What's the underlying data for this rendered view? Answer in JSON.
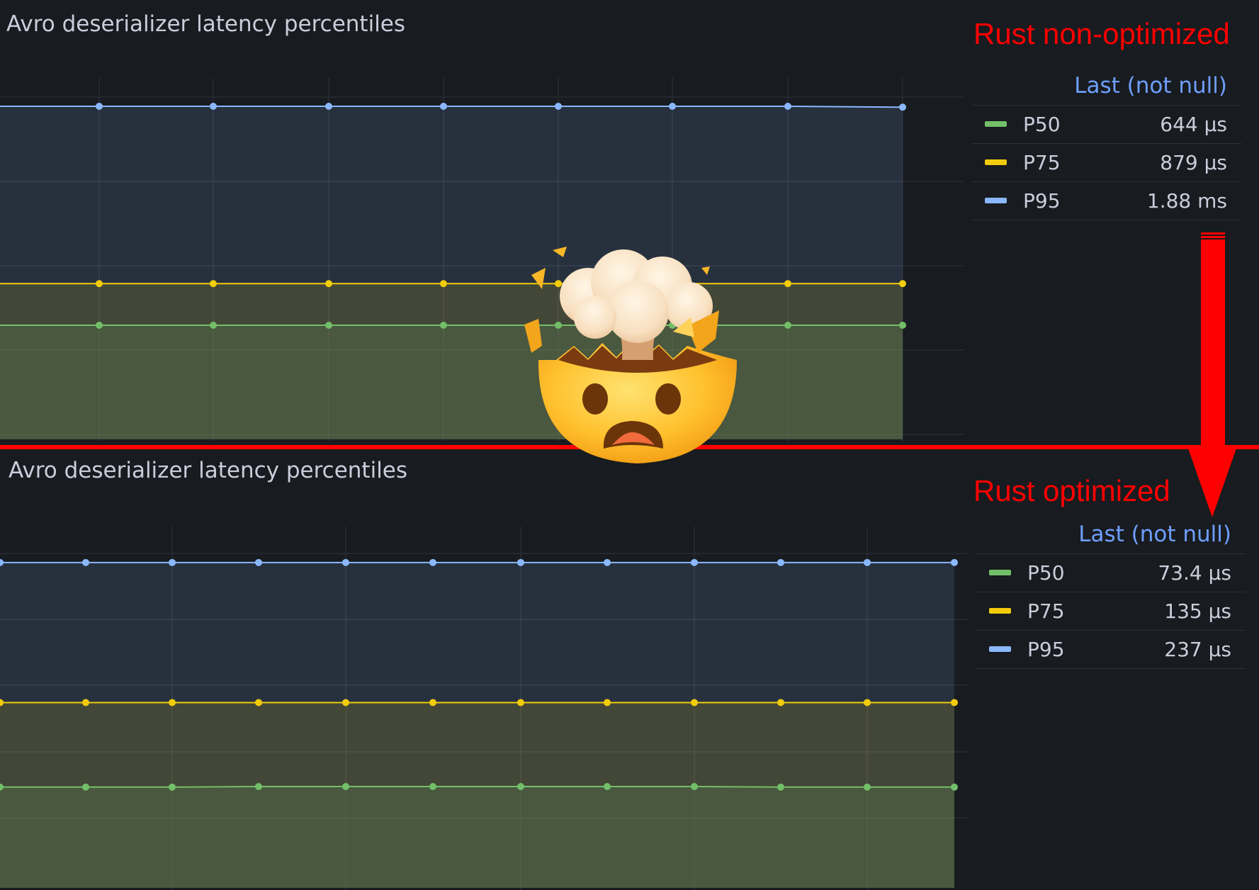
{
  "colors": {
    "p50": "#73bf69",
    "p75": "#f2cc0c",
    "p95": "#8ab8ff",
    "annotation": "#ff0000",
    "legend_header": "#6e9fff",
    "background": "#181b1f"
  },
  "annotations": {
    "top_label": "Rust non-optimized",
    "bottom_label": "Rust optimized",
    "arrow_icon": "down-arrow",
    "emoji_icon": "exploding-head"
  },
  "panels": [
    {
      "title": "Avro deserializer latency percentiles",
      "legend": {
        "header": "Last (not null)",
        "rows": [
          {
            "name": "P50",
            "value": "644 µs",
            "color": "#73bf69"
          },
          {
            "name": "P75",
            "value": "879 µs",
            "color": "#f2cc0c"
          },
          {
            "name": "P95",
            "value": "1.88 ms",
            "color": "#8ab8ff"
          }
        ]
      }
    },
    {
      "title": "Avro deserializer latency percentiles",
      "legend": {
        "header": "Last (not null)",
        "rows": [
          {
            "name": "P50",
            "value": "73.4 µs",
            "color": "#73bf69"
          },
          {
            "name": "P75",
            "value": "135 µs",
            "color": "#f2cc0c"
          },
          {
            "name": "P95",
            "value": "237 µs",
            "color": "#8ab8ff"
          }
        ]
      }
    }
  ],
  "chart_data": [
    {
      "type": "area",
      "title": "Avro deserializer latency percentiles",
      "unit": "µs",
      "grid": true,
      "legend_placement": "right",
      "x_points": 8,
      "ylim": [
        0,
        2480
      ],
      "series": [
        {
          "name": "P95",
          "values": [
            1880,
            1880,
            1880,
            1880,
            1880,
            1880,
            1880,
            1875
          ]
        },
        {
          "name": "P75",
          "values": [
            879,
            879,
            879,
            879,
            879,
            879,
            879,
            879
          ]
        },
        {
          "name": "P50",
          "values": [
            644,
            644,
            644,
            644,
            644,
            644,
            644,
            644
          ]
        }
      ]
    },
    {
      "type": "area",
      "title": "Avro deserializer latency percentiles",
      "unit": "µs",
      "grid": true,
      "legend_placement": "right",
      "x_points": 12,
      "ylim": [
        0,
        320
      ],
      "series": [
        {
          "name": "P95",
          "values": [
            237,
            237,
            237,
            237,
            237,
            237,
            237,
            237,
            237,
            237,
            237,
            237
          ]
        },
        {
          "name": "P75",
          "values": [
            135,
            135,
            135,
            135,
            135,
            135,
            135,
            135,
            135,
            135,
            135,
            135
          ]
        },
        {
          "name": "P50",
          "values": [
            73.4,
            73.4,
            73.4,
            73.8,
            73.8,
            73.8,
            73.8,
            73.8,
            73.8,
            73.4,
            73.4,
            73.4
          ]
        }
      ]
    }
  ]
}
